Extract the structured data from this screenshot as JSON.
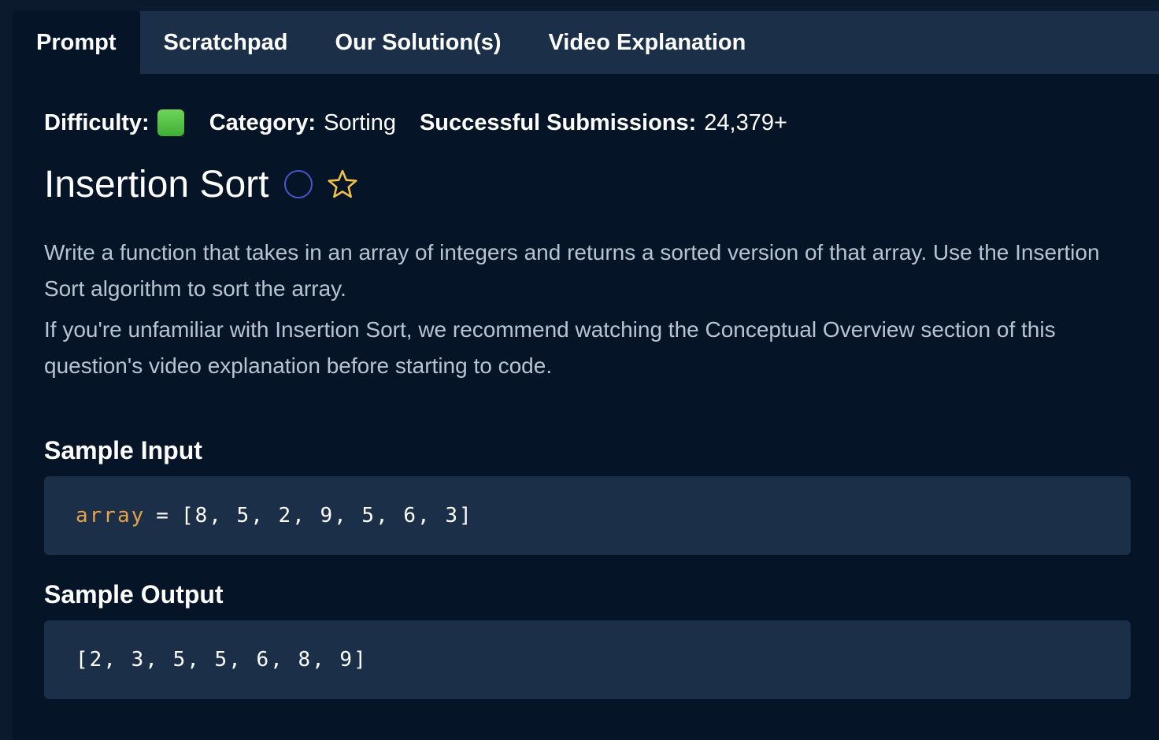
{
  "tabs": [
    {
      "label": "Prompt"
    },
    {
      "label": "Scratchpad"
    },
    {
      "label": "Our Solution(s)"
    },
    {
      "label": "Video Explanation"
    }
  ],
  "meta": {
    "difficulty_label": "Difficulty:",
    "difficulty_color": "#5bc24a",
    "category_label": "Category:",
    "category_value": "Sorting",
    "submissions_label": "Successful Submissions:",
    "submissions_value": "24,379+"
  },
  "question": {
    "title": "Insertion Sort",
    "status_icon": "circle-outline-icon",
    "favorite_icon": "star-outline-icon",
    "description_1": "Write a function that takes in an array of integers and returns a sorted version of that array. Use the Insertion Sort algorithm to sort the array.",
    "description_2": "If you're unfamiliar with Insertion Sort, we recommend watching the Conceptual Overview section of this question's video explanation before starting to code."
  },
  "sample_input": {
    "label": "Sample Input",
    "variable": "array",
    "operator": "=",
    "value": "[8, 5, 2, 9, 5, 6, 3]"
  },
  "sample_output": {
    "label": "Sample Output",
    "value": "[2, 3, 5, 5, 6, 8, 9]"
  }
}
